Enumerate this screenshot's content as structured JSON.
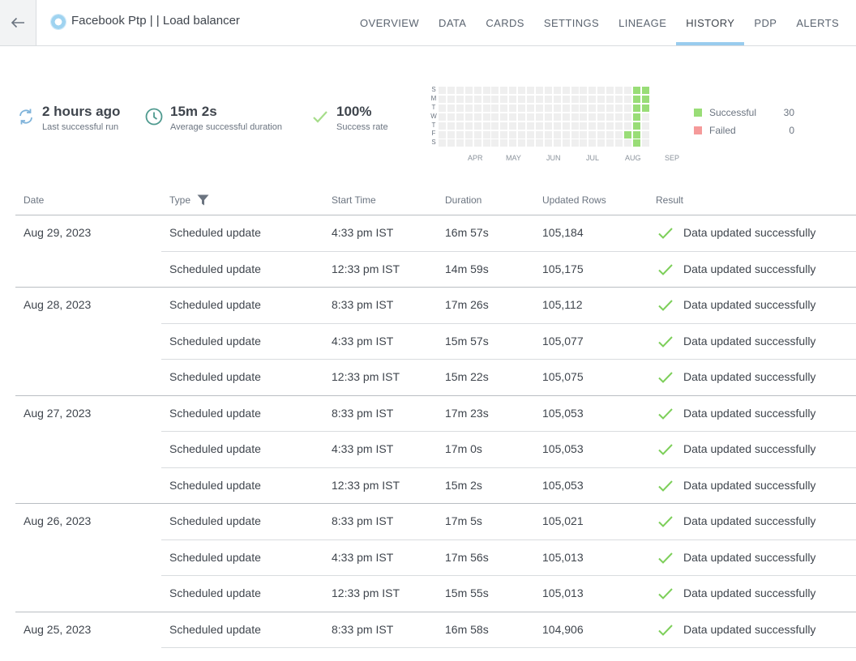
{
  "header": {
    "title": "Facebook Ptp |  | Load balancer",
    "tabs": [
      {
        "label": "OVERVIEW"
      },
      {
        "label": "DATA"
      },
      {
        "label": "CARDS"
      },
      {
        "label": "SETTINGS"
      },
      {
        "label": "LINEAGE"
      },
      {
        "label": "HISTORY",
        "active": true
      },
      {
        "label": "PDP"
      },
      {
        "label": "ALERTS"
      }
    ]
  },
  "summary": {
    "last_run": {
      "value": "2 hours ago",
      "label": "Last successful run"
    },
    "avg_duration": {
      "value": "15m 2s",
      "label": "Average successful duration"
    },
    "success_rate": {
      "value": "100%",
      "label": "Success rate"
    }
  },
  "calendar": {
    "day_labels": [
      "S",
      "M",
      "T",
      "W",
      "T",
      "F",
      "S"
    ],
    "months": [
      "APR",
      "MAY",
      "JUN",
      "JUL",
      "AUG",
      "SEP"
    ],
    "colors": {
      "empty": "#efefef",
      "success": "#99dd77",
      "failed": "#f59a9a"
    }
  },
  "legend": {
    "successful": {
      "label": "Successful",
      "count": "30",
      "color": "#99dd77"
    },
    "failed": {
      "label": "Failed",
      "count": "0",
      "color": "#f59a9a"
    }
  },
  "table": {
    "columns": {
      "date": "Date",
      "type": "Type",
      "start": "Start Time",
      "duration": "Duration",
      "rows": "Updated Rows",
      "result": "Result"
    },
    "rows": [
      {
        "date": "Aug 29, 2023",
        "type": "Scheduled update",
        "start": "4:33 pm IST",
        "duration": "16m 57s",
        "rows": "105,184",
        "result": "Data updated successfully"
      },
      {
        "date": "",
        "type": "Scheduled update",
        "start": "12:33 pm IST",
        "duration": "14m 59s",
        "rows": "105,175",
        "result": "Data updated successfully"
      },
      {
        "date": "Aug 28, 2023",
        "type": "Scheduled update",
        "start": "8:33 pm IST",
        "duration": "17m 26s",
        "rows": "105,112",
        "result": "Data updated successfully"
      },
      {
        "date": "",
        "type": "Scheduled update",
        "start": "4:33 pm IST",
        "duration": "15m 57s",
        "rows": "105,077",
        "result": "Data updated successfully"
      },
      {
        "date": "",
        "type": "Scheduled update",
        "start": "12:33 pm IST",
        "duration": "15m 22s",
        "rows": "105,075",
        "result": "Data updated successfully"
      },
      {
        "date": "Aug 27, 2023",
        "type": "Scheduled update",
        "start": "8:33 pm IST",
        "duration": "17m 23s",
        "rows": "105,053",
        "result": "Data updated successfully"
      },
      {
        "date": "",
        "type": "Scheduled update",
        "start": "4:33 pm IST",
        "duration": "17m 0s",
        "rows": "105,053",
        "result": "Data updated successfully"
      },
      {
        "date": "",
        "type": "Scheduled update",
        "start": "12:33 pm IST",
        "duration": "15m 2s",
        "rows": "105,053",
        "result": "Data updated successfully"
      },
      {
        "date": "Aug 26, 2023",
        "type": "Scheduled update",
        "start": "8:33 pm IST",
        "duration": "17m 5s",
        "rows": "105,021",
        "result": "Data updated successfully"
      },
      {
        "date": "",
        "type": "Scheduled update",
        "start": "4:33 pm IST",
        "duration": "17m 56s",
        "rows": "105,013",
        "result": "Data updated successfully"
      },
      {
        "date": "",
        "type": "Scheduled update",
        "start": "12:33 pm IST",
        "duration": "15m 55s",
        "rows": "105,013",
        "result": "Data updated successfully"
      },
      {
        "date": "Aug 25, 2023",
        "type": "Scheduled update",
        "start": "8:33 pm IST",
        "duration": "16m 58s",
        "rows": "104,906",
        "result": "Data updated successfully"
      }
    ]
  }
}
